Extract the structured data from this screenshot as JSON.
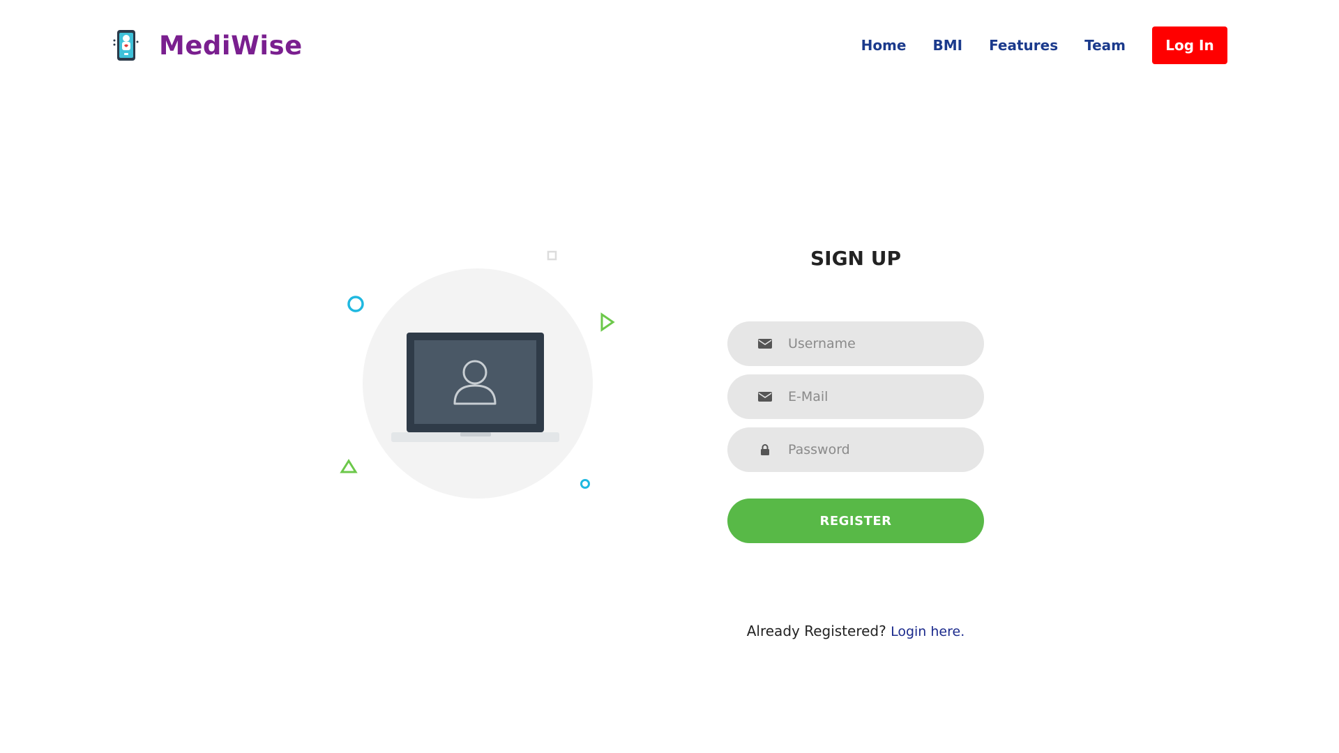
{
  "brand": {
    "name": "MediWise",
    "logo_icon": "phone-doctor-icon"
  },
  "nav": {
    "items": [
      "Home",
      "BMI",
      "Features",
      "Team"
    ],
    "login_label": "Log In"
  },
  "illustration": {
    "icon": "laptop-user-icon"
  },
  "signup": {
    "title": "SIGN UP",
    "username": {
      "placeholder": "Username",
      "value": "",
      "icon": "envelope-icon"
    },
    "email": {
      "placeholder": "E-Mail",
      "value": "",
      "icon": "envelope-icon"
    },
    "password": {
      "placeholder": "Password",
      "value": "",
      "icon": "lock-icon"
    },
    "register_label": "REGISTER",
    "already_text": "Already Registered?",
    "login_link": "Login here."
  },
  "colors": {
    "brand": "#7a1f8f",
    "nav_text": "#1b3a8c",
    "login_button": "#ff0000",
    "register_button": "#58b947",
    "field_bg": "#e6e6e6"
  }
}
